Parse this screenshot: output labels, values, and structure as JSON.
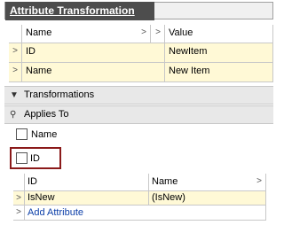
{
  "panel": {
    "title": "Attribute Transformation"
  },
  "properties_grid": {
    "columns": [
      "Name",
      "Value"
    ],
    "rows": [
      {
        "name": "ID",
        "value": "NewItem"
      },
      {
        "name": "Name",
        "value": "New Item"
      }
    ]
  },
  "sections": {
    "transformations": "Transformations",
    "applies_to": "Applies To"
  },
  "applies_to_options": [
    {
      "label": "Name",
      "checked": false
    },
    {
      "label": "ID",
      "checked": false
    }
  ],
  "attributes_grid": {
    "columns": [
      "ID",
      "Name"
    ],
    "rows": [
      {
        "id": "IsNew",
        "name": "(IsNew)"
      }
    ],
    "add_label": "Add Attribute"
  },
  "icons": {
    "row_pointer": "chevron-right-icon",
    "collapse": "collapse-arrow-icon",
    "applies_to": "pin-icon"
  },
  "colors": {
    "title_bg": "#4d4d4d",
    "row_highlight": "#fff9d6",
    "focus_border": "#8b1a1a",
    "link": "#0b3ea8"
  }
}
